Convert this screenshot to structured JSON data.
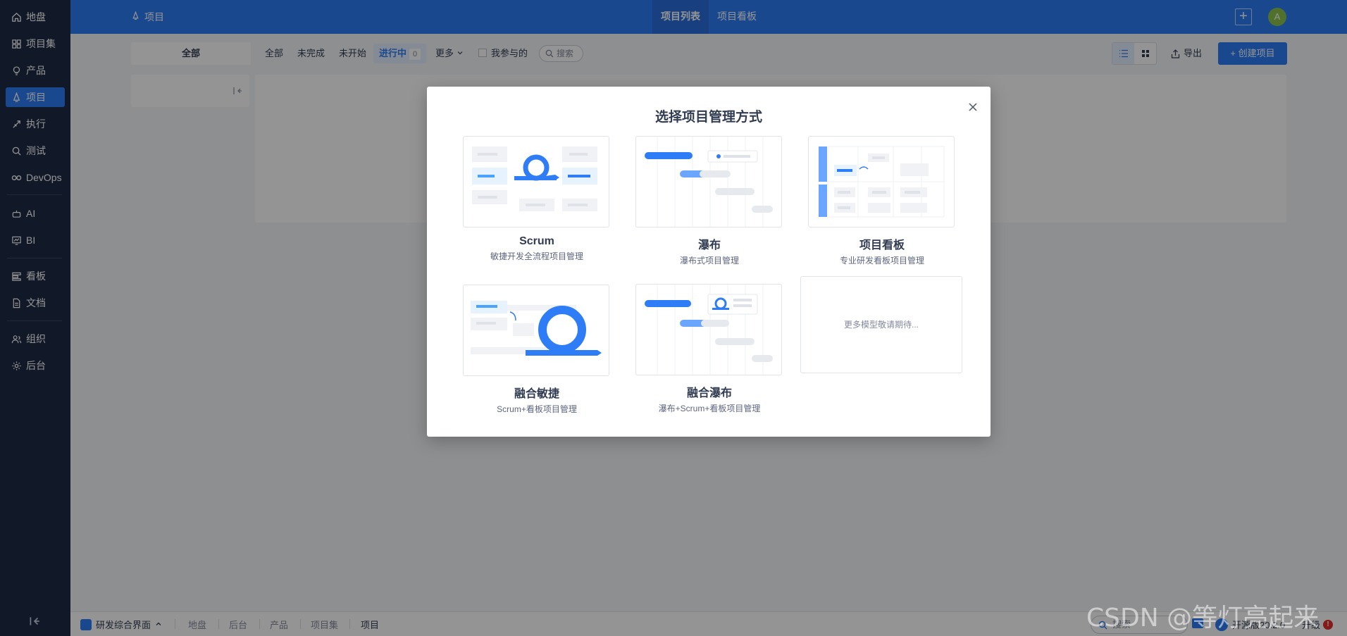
{
  "sidebar": {
    "items": [
      {
        "label": "地盘",
        "icon": "home-icon"
      },
      {
        "label": "项目集",
        "icon": "grid-icon"
      },
      {
        "label": "产品",
        "icon": "lightbulb-icon"
      },
      {
        "label": "项目",
        "icon": "rocket-icon",
        "active": true
      },
      {
        "label": "执行",
        "icon": "run-icon"
      },
      {
        "label": "测试",
        "icon": "bug-icon"
      },
      {
        "label": "DevOps",
        "icon": "infinity-icon"
      },
      {
        "label": "AI",
        "icon": "robot-icon"
      },
      {
        "label": "BI",
        "icon": "chart-icon"
      },
      {
        "label": "看板",
        "icon": "kanban-icon"
      },
      {
        "label": "文档",
        "icon": "doc-icon"
      },
      {
        "label": "组织",
        "icon": "users-icon"
      },
      {
        "label": "后台",
        "icon": "gear-icon"
      }
    ]
  },
  "header": {
    "crumb": "项目",
    "tabs": [
      "项目列表",
      "项目看板"
    ],
    "avatar": "A"
  },
  "toolbar": {
    "left_pill": "全部",
    "filters": [
      "全部",
      "未完成",
      "未开始"
    ],
    "active_filter": "进行中",
    "active_count": "0",
    "more": "更多",
    "mine": "我参与的",
    "search": "搜索",
    "export": "导出",
    "create": "+ 创建项目"
  },
  "modal": {
    "title": "选择项目管理方式",
    "cards": [
      {
        "title": "Scrum",
        "sub": "敏捷开发全流程项目管理"
      },
      {
        "title": "瀑布",
        "sub": "瀑布式项目管理"
      },
      {
        "title": "项目看板",
        "sub": "专业研发看板项目管理"
      },
      {
        "title": "融合敏捷",
        "sub": "Scrum+看板项目管理"
      },
      {
        "title": "融合瀑布",
        "sub": "瀑布+Scrum+看板项目管理"
      }
    ],
    "more": "更多模型敬请期待..."
  },
  "bottombar": {
    "app": "研发综合界面",
    "tabs": [
      "地盘",
      "后台",
      "产品",
      "项目集",
      "项目"
    ],
    "search": "搜索",
    "version": "开源版20.2.0",
    "upgrade": "升级",
    "alert": "!"
  },
  "watermark": "CSDN @等灯亮起来",
  "colors": {
    "brand": "#2e7cf6",
    "sidebar": "#1e2a46"
  }
}
